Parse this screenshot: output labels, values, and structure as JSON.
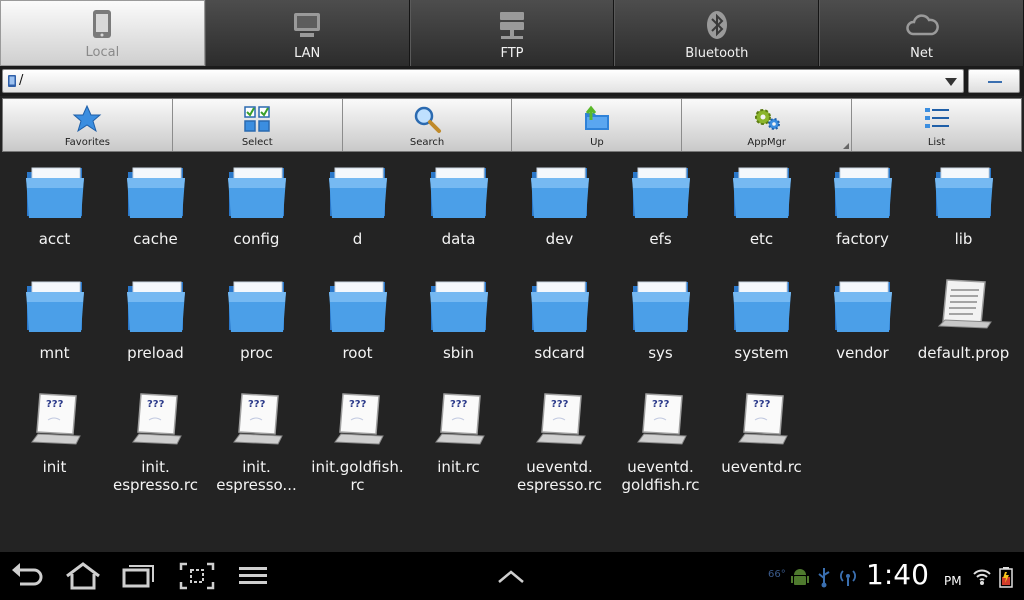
{
  "tabs": [
    {
      "label": "Local",
      "icon": "tablet-icon",
      "active": true
    },
    {
      "label": "LAN",
      "icon": "monitor-icon",
      "active": false
    },
    {
      "label": "FTP",
      "icon": "server-icon",
      "active": false
    },
    {
      "label": "Bluetooth",
      "icon": "bluetooth-icon",
      "active": false
    },
    {
      "label": "Net",
      "icon": "cloud-icon",
      "active": false
    }
  ],
  "path": {
    "value": "/"
  },
  "toolbar": [
    {
      "label": "Favorites",
      "icon": "star-icon"
    },
    {
      "label": "Select",
      "icon": "select-grid-icon"
    },
    {
      "label": "Search",
      "icon": "magnifier-icon"
    },
    {
      "label": "Up",
      "icon": "folder-up-icon"
    },
    {
      "label": "AppMgr",
      "icon": "gears-icon"
    },
    {
      "label": "List",
      "icon": "list-icon"
    }
  ],
  "files": [
    {
      "name": "acct",
      "type": "folder"
    },
    {
      "name": "cache",
      "type": "folder"
    },
    {
      "name": "config",
      "type": "folder"
    },
    {
      "name": "d",
      "type": "folder"
    },
    {
      "name": "data",
      "type": "folder"
    },
    {
      "name": "dev",
      "type": "folder"
    },
    {
      "name": "efs",
      "type": "folder"
    },
    {
      "name": "etc",
      "type": "folder"
    },
    {
      "name": "factory",
      "type": "folder"
    },
    {
      "name": "lib",
      "type": "folder"
    },
    {
      "name": "mnt",
      "type": "folder"
    },
    {
      "name": "preload",
      "type": "folder"
    },
    {
      "name": "proc",
      "type": "folder"
    },
    {
      "name": "root",
      "type": "folder"
    },
    {
      "name": "sbin",
      "type": "folder"
    },
    {
      "name": "sdcard",
      "type": "folder"
    },
    {
      "name": "sys",
      "type": "folder"
    },
    {
      "name": "system",
      "type": "folder"
    },
    {
      "name": "vendor",
      "type": "folder"
    },
    {
      "name": "default.prop",
      "type": "text"
    },
    {
      "name": "init",
      "type": "unknown"
    },
    {
      "name": "init.\nespresso.rc",
      "type": "unknown"
    },
    {
      "name": "init.\nespresso...",
      "type": "unknown"
    },
    {
      "name": "init.goldfish.\nrc",
      "type": "unknown"
    },
    {
      "name": "init.rc",
      "type": "unknown"
    },
    {
      "name": "ueventd.\nespresso.rc",
      "type": "unknown"
    },
    {
      "name": "ueventd.\ngoldfish.rc",
      "type": "unknown"
    },
    {
      "name": "ueventd.rc",
      "type": "unknown"
    }
  ],
  "unknown_glyph": "???",
  "system": {
    "temperature": "66°",
    "time": "1:40",
    "ampm": "PM",
    "nav": [
      "back-icon",
      "home-icon",
      "recent-apps-icon",
      "screenshot-icon",
      "menu-icon",
      "chevron-up-icon"
    ],
    "status_icons": [
      "android-icon",
      "usb-icon",
      "wireless-icon",
      "wifi-icon",
      "battery-icon"
    ]
  }
}
